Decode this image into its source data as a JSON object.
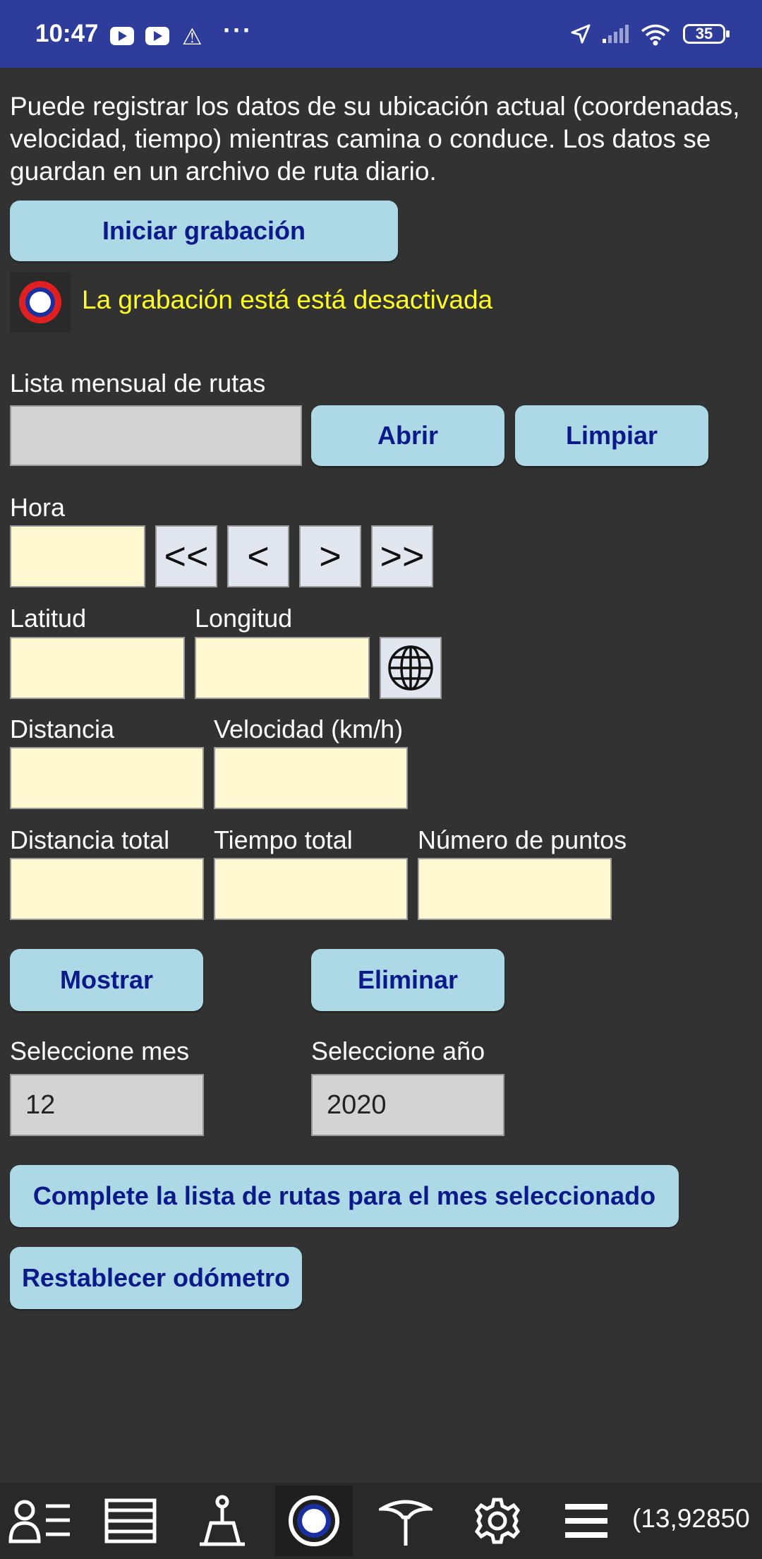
{
  "status_bar": {
    "time": "10:47",
    "battery": "35",
    "icons": [
      "youtube-icon",
      "youtube-icon",
      "warning-icon",
      "more-dots-icon",
      "location-arrow-icon",
      "signal-icon",
      "wifi-icon",
      "battery-icon"
    ]
  },
  "intro_text": "Puede registrar los datos de su ubicación actual (coordenadas, velocidad, tiempo) mientras camina o conduce. Los datos se guardan en un archivo de ruta diario.",
  "recording": {
    "start_button": "Iniciar grabación",
    "status_text": "La grabación está está desactivada",
    "status_color": "#ffff22"
  },
  "route_list": {
    "label": "Lista mensual de rutas",
    "selected": "",
    "open_button": "Abrir",
    "clear_button": "Limpiar"
  },
  "time_nav": {
    "label": "Hora",
    "value": "",
    "first": "<<",
    "prev": "<",
    "next": ">",
    "last": ">>"
  },
  "coords": {
    "lat_label": "Latitud",
    "lat_value": "",
    "lon_label": "Longitud",
    "lon_value": ""
  },
  "speed": {
    "distance_label": "Distancia",
    "distance_value": "",
    "speed_label": "Velocidad (km/h)",
    "speed_value": ""
  },
  "totals": {
    "total_distance_label": "Distancia total",
    "total_distance_value": "",
    "total_time_label": "Tiempo total",
    "total_time_value": "",
    "points_label": "Número de puntos",
    "points_value": ""
  },
  "actions": {
    "show_button": "Mostrar",
    "delete_button": "Eliminar"
  },
  "period": {
    "month_label": "Seleccione mes",
    "month_value": "12",
    "year_label": "Seleccione año",
    "year_value": "2020"
  },
  "complete_button": "Complete la lista de rutas para el mes seleccionado",
  "reset_button": "Restablecer odómetro",
  "toolbar": {
    "icons": [
      "contacts-list-icon",
      "list-icon",
      "survey-icon",
      "record-icon",
      "pin-icon",
      "gear-icon",
      "menu-icon"
    ],
    "coords_text": "(13,92850"
  },
  "colors": {
    "background": "#323232",
    "status_bar": "#2e3d9c",
    "button_bg": "#add8e6",
    "button_text": "#0a1a8a",
    "field_bg": "#fff8d0"
  }
}
